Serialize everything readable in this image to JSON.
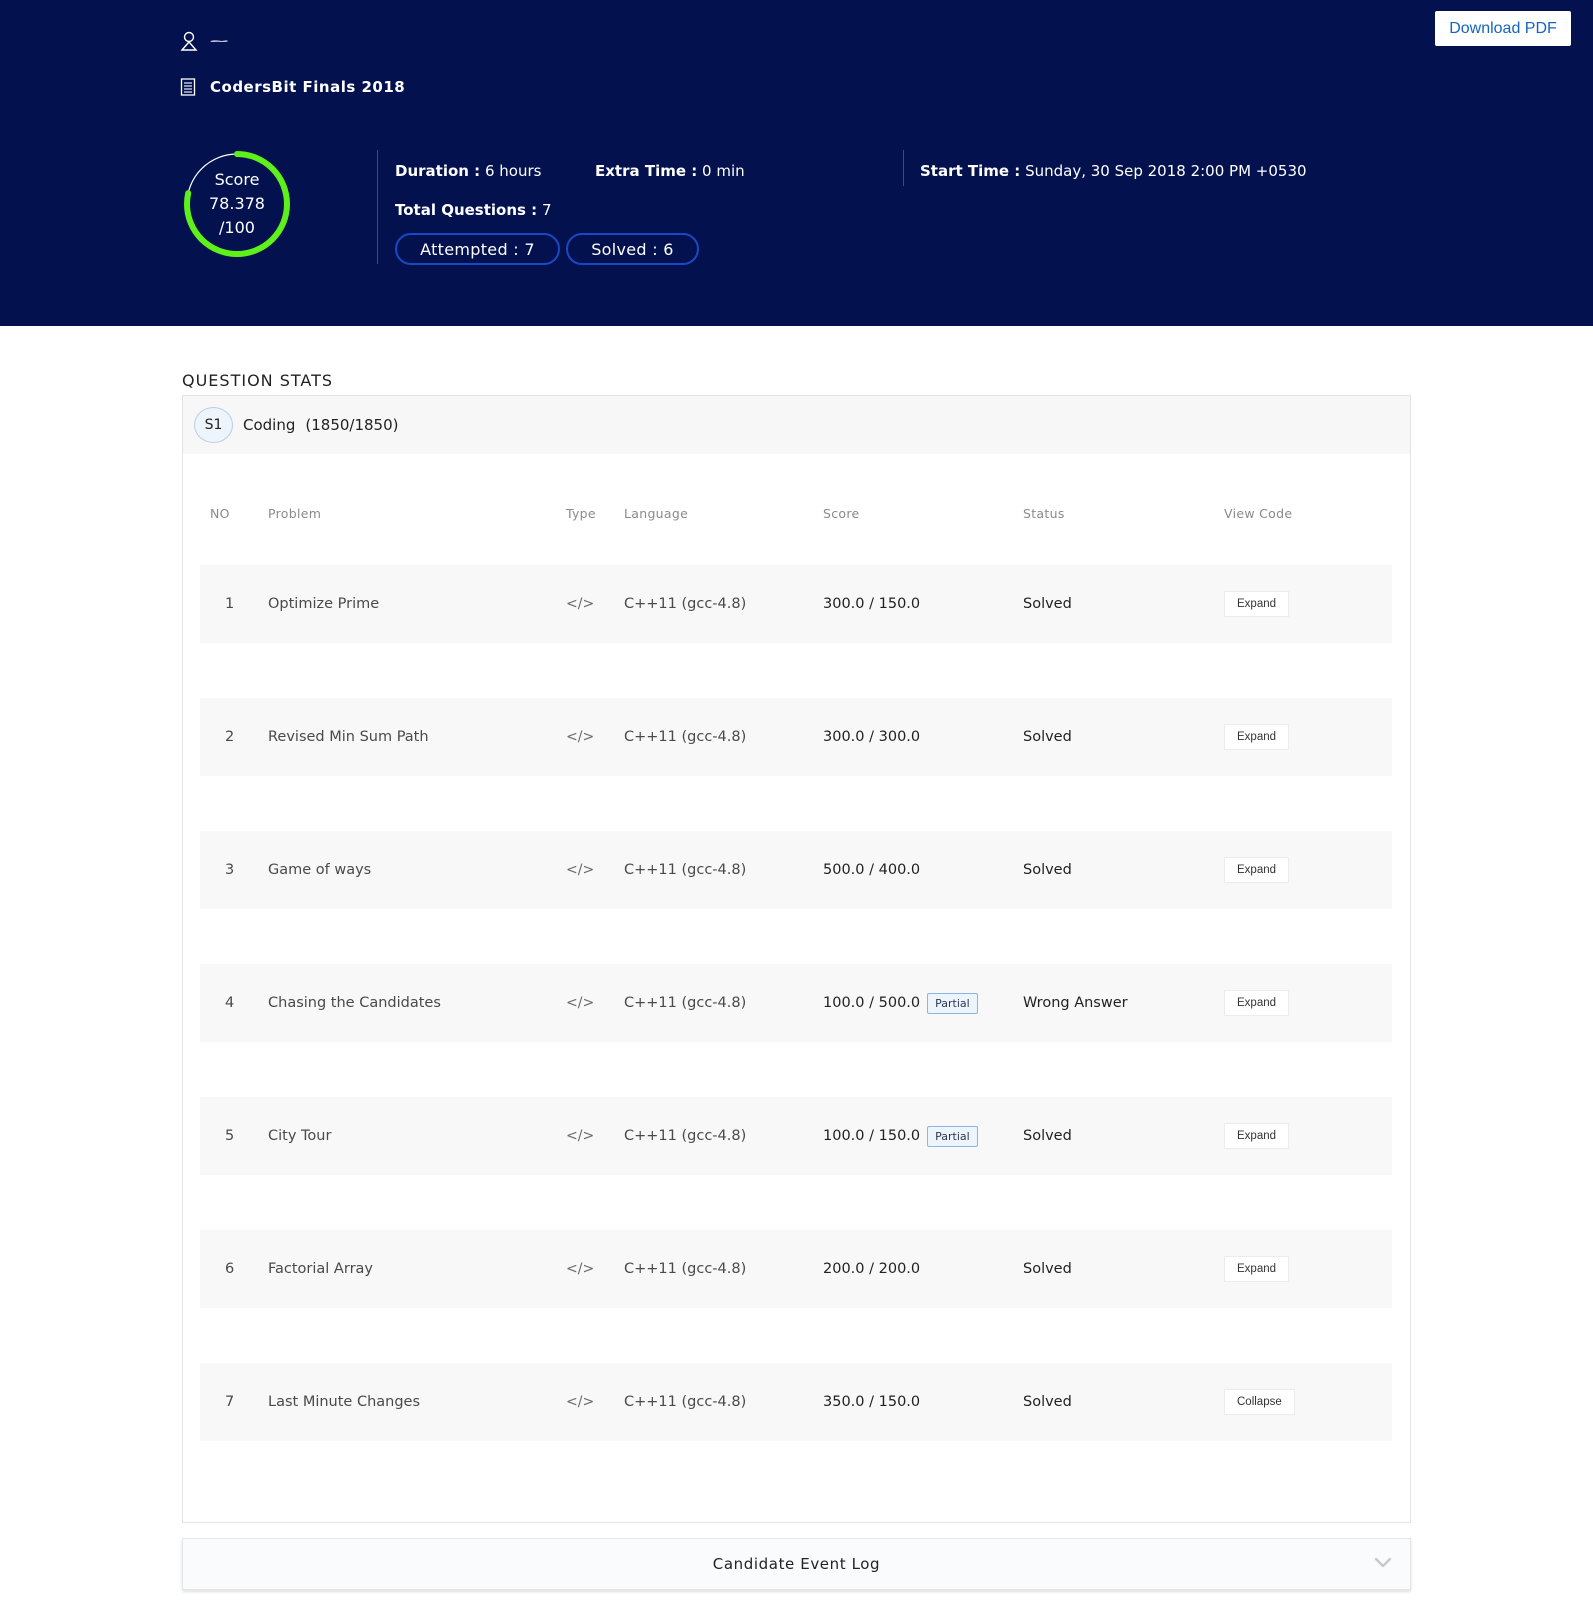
{
  "header": {
    "download_label": "Download PDF",
    "test_name": "CodersBit Finals 2018",
    "score_label": "Score",
    "score_value": "78.378",
    "score_max": "/100",
    "score_fraction": 0.78378,
    "duration": {
      "label": "Duration :",
      "value": "6 hours"
    },
    "extra_time": {
      "label": "Extra Time :",
      "value": "0 min"
    },
    "total_questions": {
      "label": "Total Questions :",
      "value": "7"
    },
    "start_time": {
      "label": "Start Time :",
      "value": "Sunday, 30 Sep 2018 2:00 PM +0530"
    },
    "attempted_label": "Attempted : 7",
    "solved_label": "Solved : 6",
    "colors": {
      "background": "#03124f",
      "ring": "#5ef01a",
      "pill_border": "#1a48c4"
    }
  },
  "question_stats": {
    "title": "QUESTION STATS",
    "section": {
      "badge": "S1",
      "title": "Coding",
      "score": "(1850/1850)"
    },
    "columns": [
      "NO",
      "Problem",
      "Type",
      "Language",
      "Score",
      "Status",
      "View Code"
    ],
    "rows": [
      {
        "no": "1",
        "problem": "Optimize Prime",
        "type": "</>",
        "language": "C++11 (gcc-4.8)",
        "score": "300.0 / 150.0",
        "partial": "",
        "status": "Solved",
        "action": "Expand"
      },
      {
        "no": "2",
        "problem": "Revised Min Sum Path",
        "type": "</>",
        "language": "C++11 (gcc-4.8)",
        "score": "300.0 / 300.0",
        "partial": "",
        "status": "Solved",
        "action": "Expand"
      },
      {
        "no": "3",
        "problem": "Game of ways",
        "type": "</>",
        "language": "C++11 (gcc-4.8)",
        "score": "500.0 / 400.0",
        "partial": "",
        "status": "Solved",
        "action": "Expand"
      },
      {
        "no": "4",
        "problem": "Chasing the Candidates",
        "type": "</>",
        "language": "C++11 (gcc-4.8)",
        "score": "100.0 / 500.0",
        "partial": "Partial",
        "status": "Wrong Answer",
        "action": "Expand"
      },
      {
        "no": "5",
        "problem": "City Tour",
        "type": "</>",
        "language": "C++11 (gcc-4.8)",
        "score": "100.0 / 150.0",
        "partial": "Partial",
        "status": "Solved",
        "action": "Expand"
      },
      {
        "no": "6",
        "problem": "Factorial Array",
        "type": "</>",
        "language": "C++11 (gcc-4.8)",
        "score": "200.0 / 200.0",
        "partial": "",
        "status": "Solved",
        "action": "Expand"
      },
      {
        "no": "7",
        "problem": "Last Minute Changes",
        "type": "</>",
        "language": "C++11 (gcc-4.8)",
        "score": "350.0 / 150.0",
        "partial": "",
        "status": "Solved",
        "action": "Collapse"
      }
    ]
  },
  "event_log": {
    "label": "Candidate Event Log",
    "icon": "chevron-down-icon"
  }
}
